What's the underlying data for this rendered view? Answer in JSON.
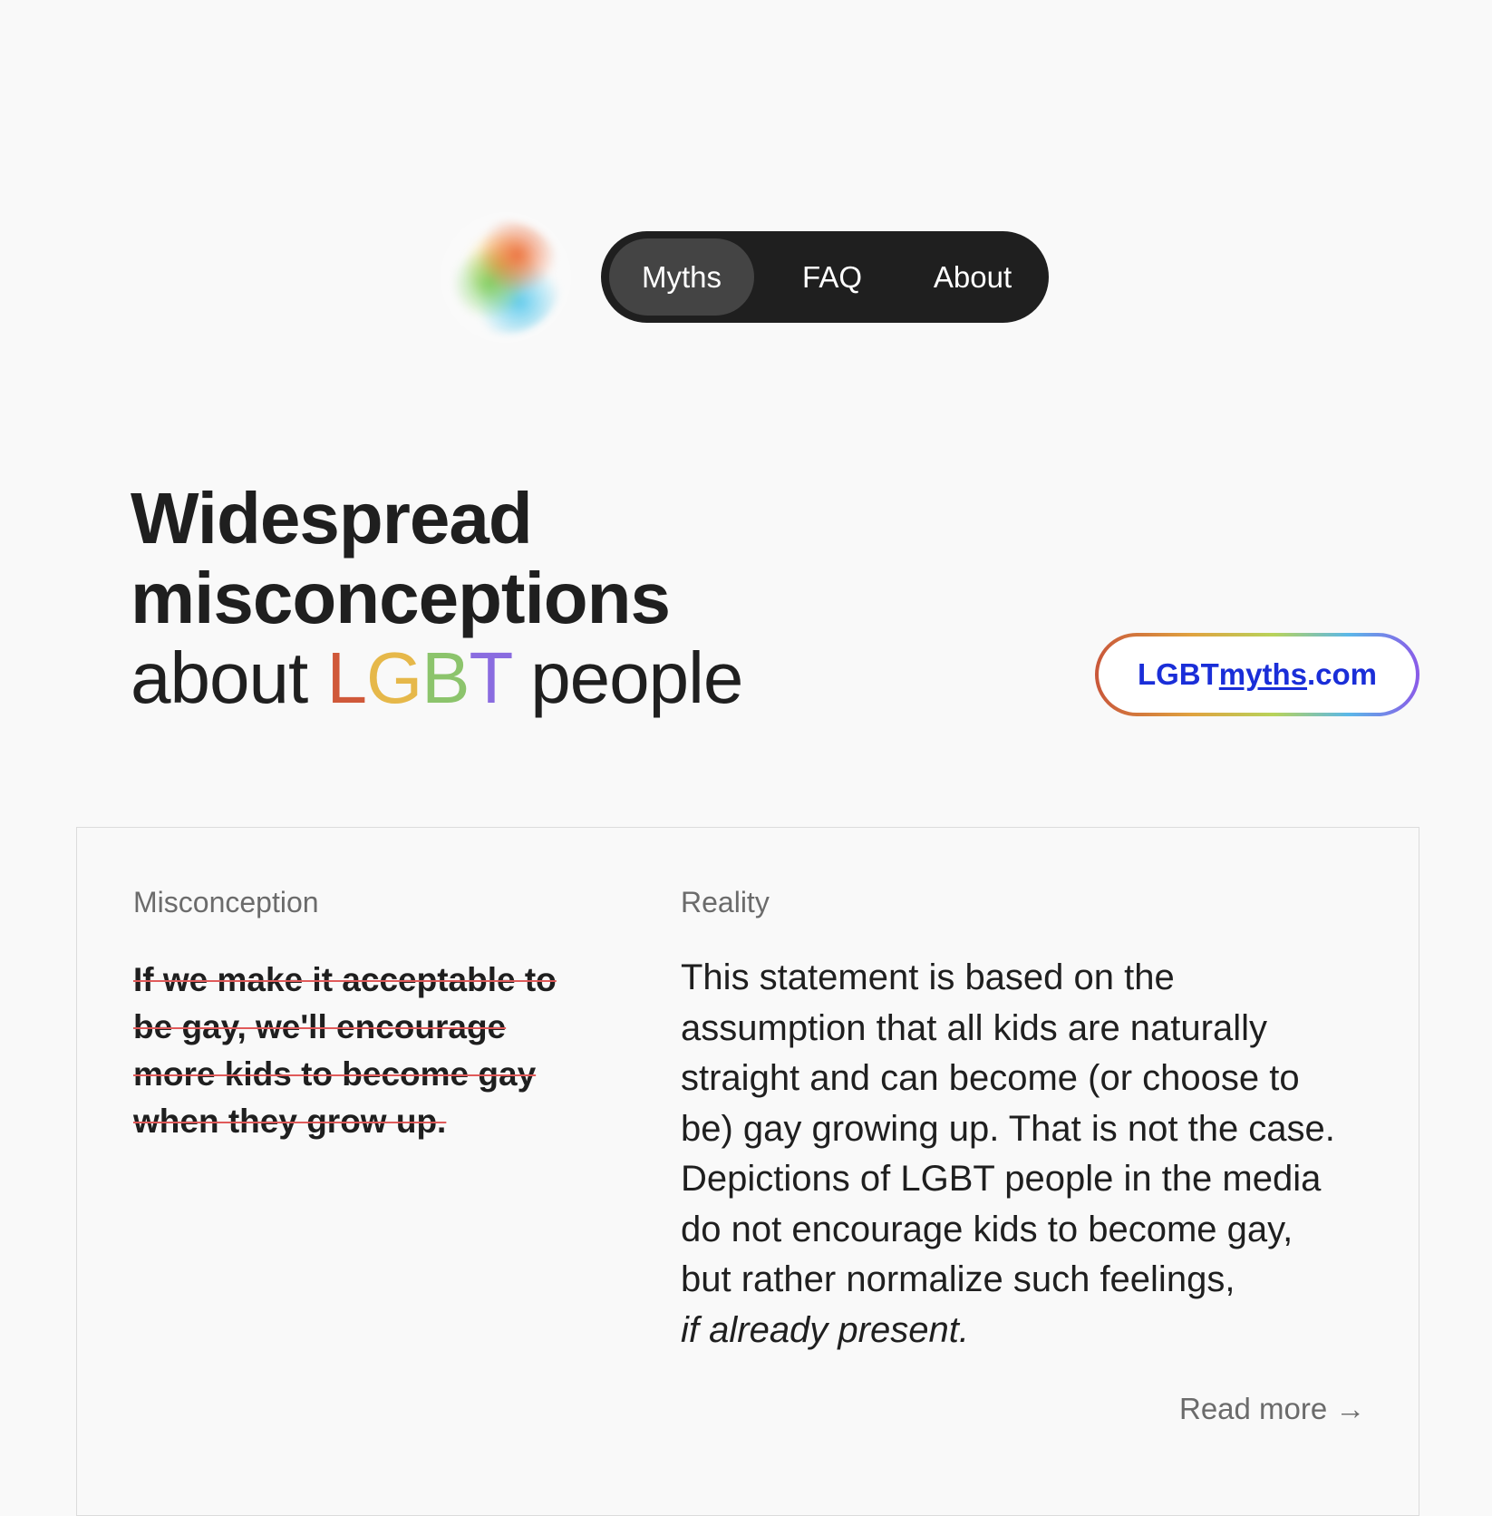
{
  "header": {
    "logo_icon": "rainbow-orb-icon",
    "nav": {
      "items": [
        {
          "label": "Myths",
          "active": true
        },
        {
          "label": "FAQ",
          "active": false
        },
        {
          "label": "About",
          "active": false
        }
      ]
    }
  },
  "hero": {
    "line1": "Widespread",
    "line2": "misconceptions",
    "line3_prefix": "about",
    "lgbt_letters": [
      "L",
      "G",
      "B",
      "T"
    ],
    "line3_suffix": "people"
  },
  "site_badge": {
    "prefix": "LGBT",
    "middle": "myths",
    "suffix": ".com"
  },
  "card": {
    "misconception_label": "Misconception",
    "reality_label": "Reality",
    "myth": "If we make it acceptable to be gay, we'll encourage more kids to become gay when they grow up.",
    "reality": "This statement is based on the assumption that all kids are naturally straight and can become (or choose to be) gay growing up. That is not the case. Depictions of LGBT people in the media do not encourage kids to become gay, but rather normalize such feelings,",
    "reality_emphasis": "if already present.",
    "read_more": "Read more →"
  },
  "colors": {
    "background": "#f9f9f9",
    "nav_background": "#1f1f1f",
    "nav_active": "#444444",
    "link_blue": "#1a2ed8",
    "strike_red": "#e05a5a",
    "lgbt_l": "#d0593a",
    "lgbt_g": "#e6b84a",
    "lgbt_b": "#8cc46c",
    "lgbt_t": "#8a6ce0"
  }
}
